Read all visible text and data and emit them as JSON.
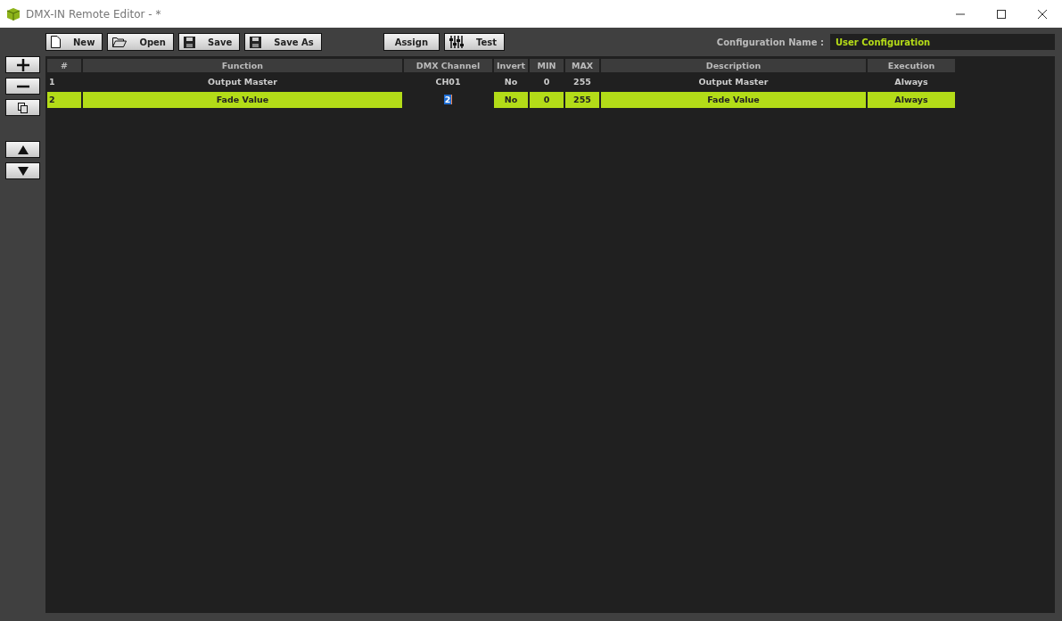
{
  "window": {
    "title": "DMX-IN Remote Editor - *"
  },
  "toolbar": [
    "New",
    "Open",
    "Save",
    "Save As",
    "Assign",
    "Test"
  ],
  "config": {
    "label": "Configuration Name :",
    "value": "User Configuration"
  },
  "table": {
    "columns": [
      "#",
      "Function",
      "DMX Channel",
      "Invert",
      "MIN",
      "MAX",
      "Description",
      "Execution"
    ],
    "rows": [
      {
        "selected": false,
        "editing": false,
        "cells": [
          "1",
          "Output Master",
          "CH01",
          "No",
          "0",
          "255",
          "Output Master",
          "Always"
        ]
      },
      {
        "selected": true,
        "editing": true,
        "cells": [
          "2",
          "Fade Value",
          "2",
          "No",
          "0",
          "255",
          "Fade Value",
          "Always"
        ]
      }
    ]
  }
}
